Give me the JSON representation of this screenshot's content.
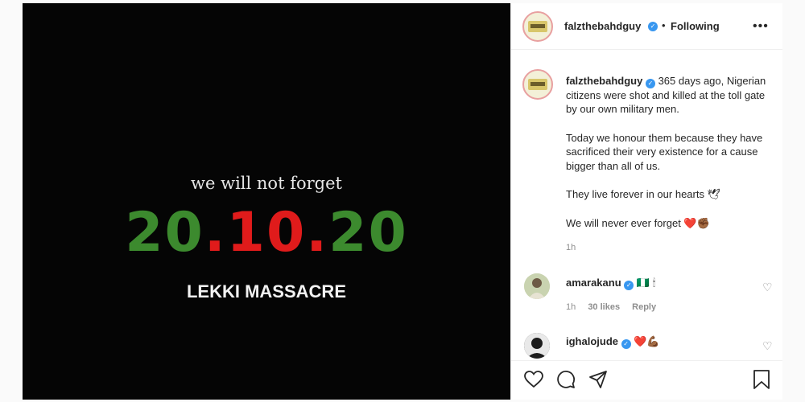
{
  "post_image": {
    "tagline": "we will not forget",
    "date": {
      "part1": "20",
      "part2": ".10.",
      "part3": "20"
    },
    "subtitle": "LEKKI MASSACRE"
  },
  "header": {
    "username": "falzthebahdguy",
    "separator": "•",
    "follow_status": "Following",
    "more_icon": "more-options-icon",
    "more_glyph": "•••"
  },
  "caption": {
    "username": "falzthebahdguy",
    "first_line": " 365 days ago, Nigerian citizens were shot and killed at the toll gate by our own military men.",
    "para2": "Today we honour them because they have sacrificed their very existence for a cause bigger than all of us.",
    "para3": "They live forever in our hearts 🕊",
    "para4": "We will never ever forget ❤️✊🏾",
    "time": "1h"
  },
  "comments": [
    {
      "username": "amarakanu",
      "text": " 🇳🇬 🕯",
      "time": "1h",
      "likes": "30 likes",
      "reply": "Reply"
    },
    {
      "username": "ighalojude",
      "text": " ❤️💪🏾"
    }
  ],
  "colors": {
    "green": "#3c8a2e",
    "red": "#e01b1b",
    "verified": "#3897f0"
  }
}
